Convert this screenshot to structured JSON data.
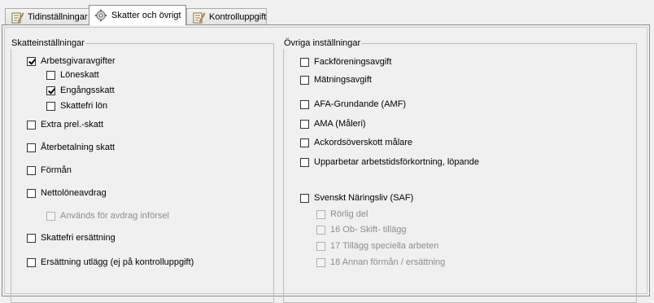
{
  "tabs": [
    {
      "label": "Tidinställningar",
      "icon": "pencil-document-icon",
      "active": false
    },
    {
      "label": "Skatter och övrigt",
      "icon": "gear-icon",
      "active": true
    },
    {
      "label": "Kontrolluppgift",
      "icon": "pencil-document-icon",
      "active": false
    }
  ],
  "tax_group": {
    "title": "Skatteinställningar",
    "arbetsgivaravgifter": {
      "label": "Arbetsgivaravgifter",
      "checked": true
    },
    "loneskatt": {
      "label": "Löneskatt",
      "checked": false
    },
    "engangsskatt": {
      "label": "Engångsskatt",
      "checked": true
    },
    "skattefri_lon": {
      "label": "Skattefri lön",
      "checked": false
    },
    "extra_prel": {
      "label": "Extra prel.-skatt",
      "checked": false
    },
    "aterbetalning": {
      "label": "Återbetalning skatt",
      "checked": false
    },
    "forman": {
      "label": "Förmån",
      "checked": false
    },
    "nettoloneavdrag": {
      "label": "Nettolöneavdrag",
      "checked": false
    },
    "anvands_infor": {
      "label": "Används för avdrag införsel",
      "checked": false,
      "disabled": true
    },
    "skattefri_ersattning": {
      "label": "Skattefri ersättning",
      "checked": false
    },
    "ersattning_utlagg": {
      "label": "Ersättning utlägg (ej på kontrolluppgift)",
      "checked": false
    }
  },
  "other_group": {
    "title": "Övriga inställningar",
    "fackforeningsavgift": {
      "label": "Fackföreningsavgift",
      "checked": false
    },
    "matningsavgift": {
      "label": "Mätningsavgift",
      "checked": false
    },
    "afa": {
      "label": "AFA-Grundande (AMF)",
      "checked": false
    },
    "ama": {
      "label": "AMA (Måleri)",
      "checked": false
    },
    "ackord": {
      "label": "Ackordsöverskott målare",
      "checked": false
    },
    "upparbetar": {
      "label": "Upparbetar arbetstidsförkortning, löpande",
      "checked": false
    },
    "saf": {
      "label": "Svenskt Näringsliv (SAF)",
      "checked": false
    },
    "rorlig_del": {
      "label": "Rörlig del",
      "checked": false,
      "disabled": true
    },
    "ob_skift": {
      "label": "16 Ob- Skift- tillägg",
      "checked": false,
      "disabled": true
    },
    "tillagg_speciella": {
      "label": "17 Tillägg speciella arbeten",
      "checked": false,
      "disabled": true
    },
    "annan_forman": {
      "label": "18 Annan förmån / ersättning",
      "checked": false,
      "disabled": true
    }
  }
}
